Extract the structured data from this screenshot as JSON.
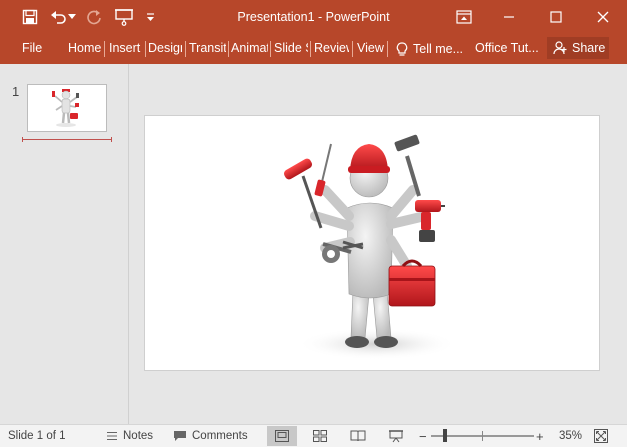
{
  "window": {
    "title": "Presentation1 - PowerPoint"
  },
  "quick_access": {
    "icons": [
      "save-icon",
      "undo-icon",
      "undo-dropdown-icon",
      "redo-icon",
      "present-from-beginning-icon",
      "customize-dropdown-icon"
    ]
  },
  "window_controls": {
    "icons": [
      "ribbon-display-options-icon",
      "minimize-icon",
      "maximize-icon",
      "close-icon"
    ]
  },
  "ribbon": {
    "tabs": [
      {
        "label": "File"
      },
      {
        "label": "Home"
      },
      {
        "label": "Insert"
      },
      {
        "label": "Design"
      },
      {
        "label": "Transitions"
      },
      {
        "label": "Animations"
      },
      {
        "label": "Slide Show"
      },
      {
        "label": "Review"
      },
      {
        "label": "View"
      }
    ],
    "tell_me": "Tell me...",
    "office_tut": "Office Tut...",
    "share": "Share"
  },
  "thumbnails": {
    "slide_number": "1"
  },
  "status": {
    "slide_info": "Slide 1 of 1",
    "notes": "Notes",
    "comments": "Comments",
    "zoom_minus": "−",
    "zoom_plus": "+",
    "zoom_level": "35%",
    "zoom_fraction": 0.35
  },
  "colors": {
    "accent": "#b7472a",
    "share_bg": "#a03d24",
    "statusbar_bg": "#f3f3f3"
  }
}
